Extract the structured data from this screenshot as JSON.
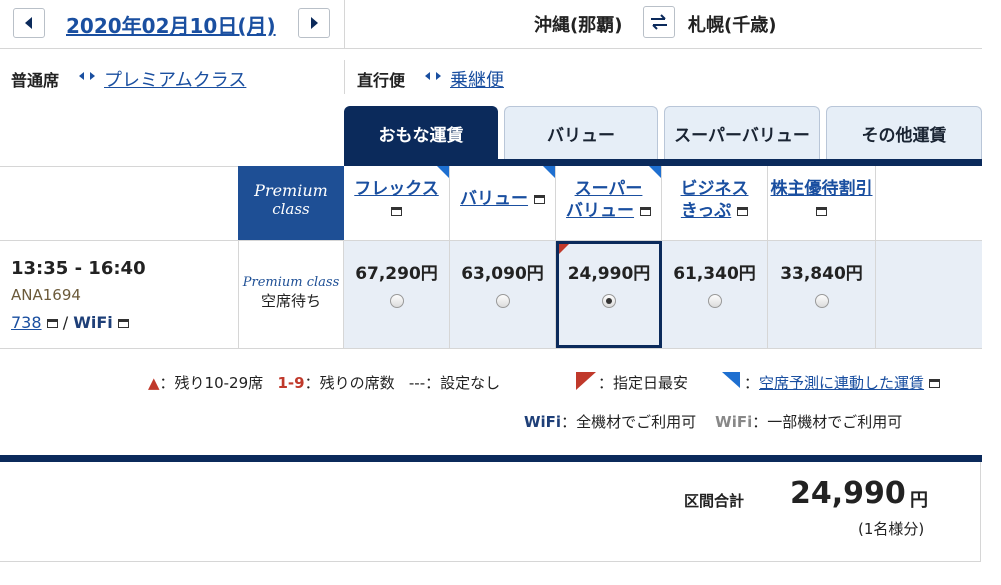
{
  "header": {
    "date": "2020年02月10日(月)",
    "origin": "沖縄(那覇)",
    "destination": "札幌(千歳)"
  },
  "filters": {
    "class_selected": "普通席",
    "class_alt": "プレミアムクラス",
    "route_selected": "直行便",
    "route_alt": "乗継便"
  },
  "tabs": [
    "おもな運賃",
    "バリュー",
    "スーパーバリュー",
    "その他運賃"
  ],
  "premium_label": {
    "line1": "Premium",
    "line2": "class"
  },
  "fare_columns": [
    {
      "line1": "フレックス",
      "line2": "",
      "blue_corner": true
    },
    {
      "line1": "バリュー",
      "line2": "",
      "blue_corner": true
    },
    {
      "line1": "スーパー",
      "line2": "バリュー",
      "blue_corner": true
    },
    {
      "line1": "ビジネス",
      "line2": "きっぷ",
      "blue_corner": false
    },
    {
      "line1": "株主優待割引",
      "line2": "",
      "blue_corner": false
    }
  ],
  "flight": {
    "time": "13:35 - 16:40",
    "number": "ANA1694",
    "aircraft": "738",
    "wifi": "WiFi",
    "premium_status_label": "Premium class",
    "premium_status": "空席待ち",
    "prices": [
      "67,290円",
      "63,090円",
      "24,990円",
      "61,340円",
      "33,840円"
    ],
    "selected_index": 2
  },
  "legend": {
    "tri_red_text": "：残り10-29席",
    "seats_num": "1-9",
    "seats_text": "：残りの席数",
    "none_mark": "---",
    "none_text": "：設定なし",
    "cheapest_text": "：指定日最安",
    "linked_text": "空席予測に連動した運賃",
    "wifi_all_mark": "WiFi",
    "wifi_all_text": "：全機材でご利用可",
    "wifi_some_mark": "WiFi",
    "wifi_some_text": "：一部機材でご利用可"
  },
  "total": {
    "label": "区間合計",
    "amount": "24,990",
    "unit": "円",
    "note": "(1名様分)"
  },
  "colors": {
    "navy": "#0b2a5b",
    "link": "#1a4fa0",
    "red": "#c0392b",
    "blue_corner": "#1e6fd0"
  }
}
